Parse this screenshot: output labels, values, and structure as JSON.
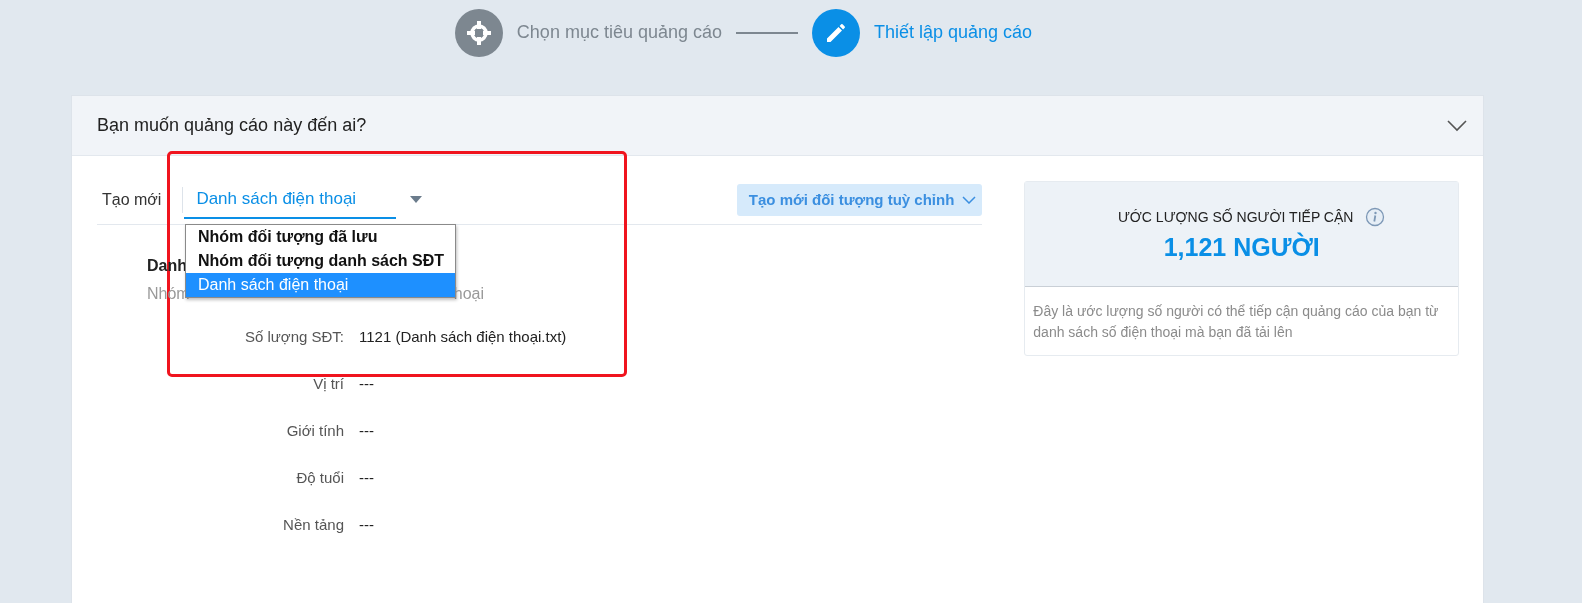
{
  "steps": [
    {
      "label": "Chọn mục tiêu quảng cáo",
      "kind": "target",
      "selected": false
    },
    {
      "label": "Thiết lập quảng cáo",
      "kind": "edit",
      "selected": true
    }
  ],
  "section": {
    "title": "Bạn muốn quảng cáo này đến ai?",
    "expanded": true
  },
  "audience_form": {
    "label": "Tạo mới",
    "select_value": "Danh sách điện thoại",
    "custom_button": "Tạo mới đối tượng tuỳ chỉnh"
  },
  "dropdown_options": [
    {
      "label": "Nhóm đối tượng đã lưu",
      "selected": false
    },
    {
      "label": "Nhóm đối tượng danh sách SĐT",
      "selected": false
    },
    {
      "label": "Danh sách điện thoại",
      "selected": true
    }
  ],
  "summary": {
    "title": "Danh",
    "subtitle_start": "Nhóm",
    "subtitle_end": "hoại"
  },
  "details": [
    {
      "label": "Số lượng SĐT:",
      "value": "1121 (Danh sách điện thoại.txt)"
    },
    {
      "label": "Vị trí",
      "value": "---"
    },
    {
      "label": "Giới tính",
      "value": "---"
    },
    {
      "label": "Độ tuổi",
      "value": "---"
    },
    {
      "label": "Nền tảng",
      "value": "---"
    }
  ],
  "reach": {
    "title": "ƯỚC LƯỢNG SỐ NGƯỜI TIẾP CẬN",
    "value": "1,121 NGƯỜI",
    "note": "Đây là ước lượng số người có thể tiếp cận quảng cáo của bạn từ danh sách số điện thoại mà bạn đã tải lên"
  },
  "highlight_frame": true
}
